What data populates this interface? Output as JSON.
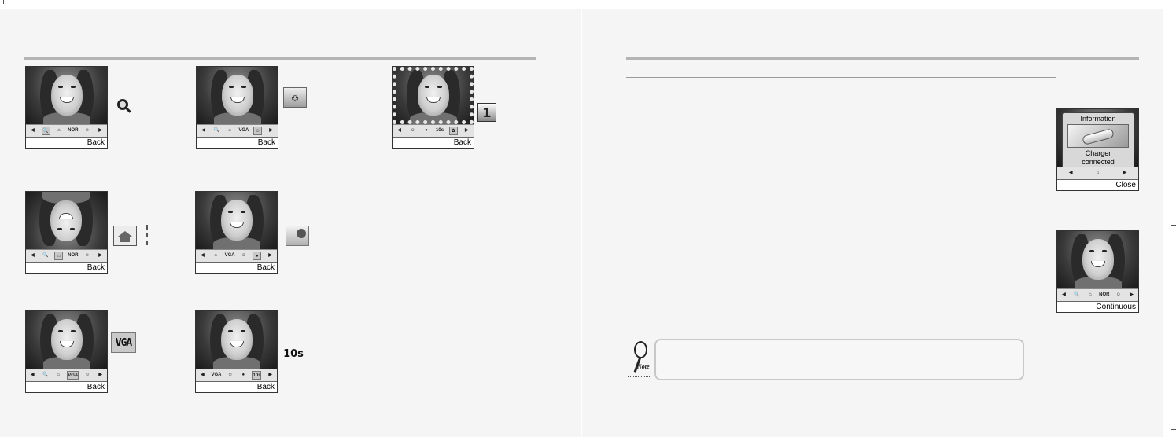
{
  "screens": [
    {
      "id": "zoom",
      "softkey": "Back",
      "toolbar": [
        "◀",
        "🔍",
        "⌂",
        "NOR",
        "☺",
        "▶"
      ],
      "selected_tool": 1
    },
    {
      "id": "effect",
      "softkey": "Back",
      "toolbar": [
        "◀",
        "🔍",
        "⌂",
        "VGA",
        "☺",
        "▶"
      ],
      "selected_tool": 4
    },
    {
      "id": "frame",
      "softkey": "Back",
      "toolbar": [
        "◀",
        "☺",
        "●",
        "10s",
        "✿",
        "▶"
      ],
      "selected_tool": 4
    },
    {
      "id": "flip",
      "softkey": "Back",
      "toolbar": [
        "◀",
        "🔍",
        "⌂",
        "NOR",
        "☺",
        "▶"
      ],
      "selected_tool": 2
    },
    {
      "id": "brightness",
      "softkey": "Back",
      "toolbar": [
        "◀",
        "⌂",
        "VGA",
        "☺",
        "●",
        "▶"
      ],
      "selected_tool": 4
    },
    {
      "id": "resolution",
      "softkey": "Back",
      "toolbar": [
        "◀",
        "🔍",
        "⌂",
        "VGA",
        "☺",
        "▶"
      ],
      "selected_tool": 3
    },
    {
      "id": "timer",
      "softkey": "Back",
      "toolbar": [
        "◀",
        "VGA",
        "☺",
        "●",
        "10s",
        "▶"
      ],
      "selected_tool": 4
    },
    {
      "id": "info",
      "softkey": "Close",
      "toolbar": [
        "◀",
        "",
        "⌂",
        "",
        "",
        "▶"
      ],
      "selected_tool": -1,
      "popup": {
        "title": "Information",
        "message_line1": "Charger",
        "message_line2": "connected"
      }
    },
    {
      "id": "continuous",
      "softkey": "Continuous",
      "toolbar": [
        "◀",
        "🔍",
        "⌂",
        "NOR",
        "☺",
        "▶"
      ],
      "selected_tool": 1
    }
  ],
  "side_icons": {
    "zoom": "zoom-icon",
    "effect": "effect-icon",
    "frame": {
      "name": "frame-number-icon",
      "label": "1"
    },
    "flip": "flip-icon",
    "brightness": "brightness-icon",
    "resolution": {
      "name": "resolution-icon",
      "label": "VGA"
    },
    "timer": {
      "name": "self-timer-icon",
      "label": "10s"
    }
  },
  "note": {
    "label": "Note"
  }
}
